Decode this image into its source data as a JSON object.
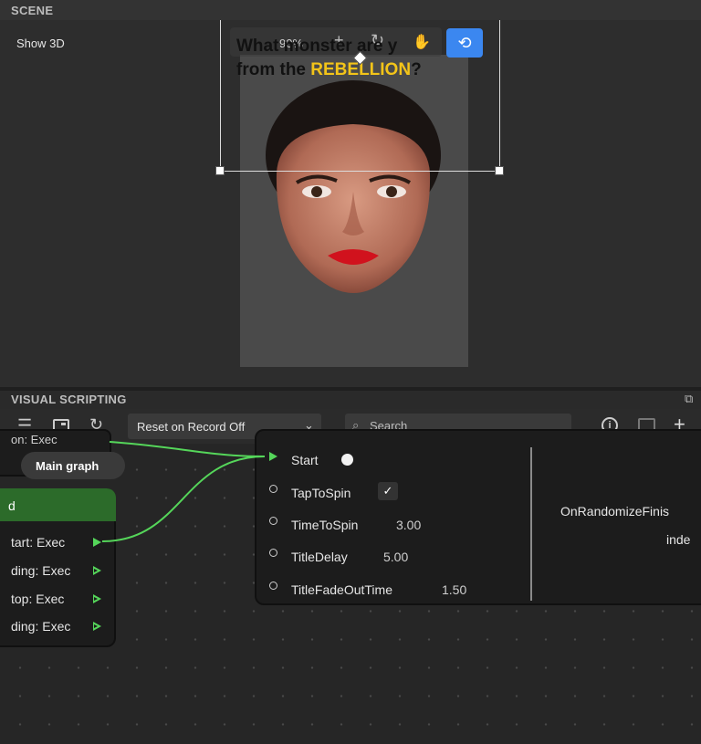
{
  "scene": {
    "header": "SCENE",
    "show_3d": "Show 3D",
    "toolbar": {
      "zoom": "90%",
      "plus_icon": "plus-icon",
      "reset_icon": "rotate-icon",
      "hand_icon": "hand-icon",
      "orbit_icon": "orbit-icon"
    },
    "quiz": {
      "line1": "What monster are y",
      "line2_prefix": "from the ",
      "line2_highlight": "REBELLION",
      "line2_suffix": "?"
    },
    "colors": {
      "accent": "#3b87f0",
      "highlight": "#f3c419"
    }
  },
  "visual_scripting": {
    "header": "VISUAL SCRIPTING",
    "toolbar": {
      "record_option": "Reset on Record Off",
      "search_placeholder": "Search"
    },
    "main_graph": "Main graph",
    "left_node": {
      "title": "d",
      "top_partial": "on: Exec",
      "rows": [
        "tart: Exec",
        "ding: Exec",
        "top: Exec",
        "ding: Exec"
      ]
    },
    "main_node": {
      "rows": [
        {
          "label": "Start",
          "value": ""
        },
        {
          "label": "TapToSpin",
          "value": "✓"
        },
        {
          "label": "TimeToSpin",
          "value": "3.00"
        },
        {
          "label": "TitleDelay",
          "value": "5.00"
        },
        {
          "label": "TitleFadeOutTime",
          "value": "1.50"
        }
      ],
      "output_label": "OnRandomizeFinis",
      "output_sub": "inde"
    },
    "colors": {
      "exec_green": "#55d65a",
      "node_header": "#2c6b2a"
    }
  }
}
